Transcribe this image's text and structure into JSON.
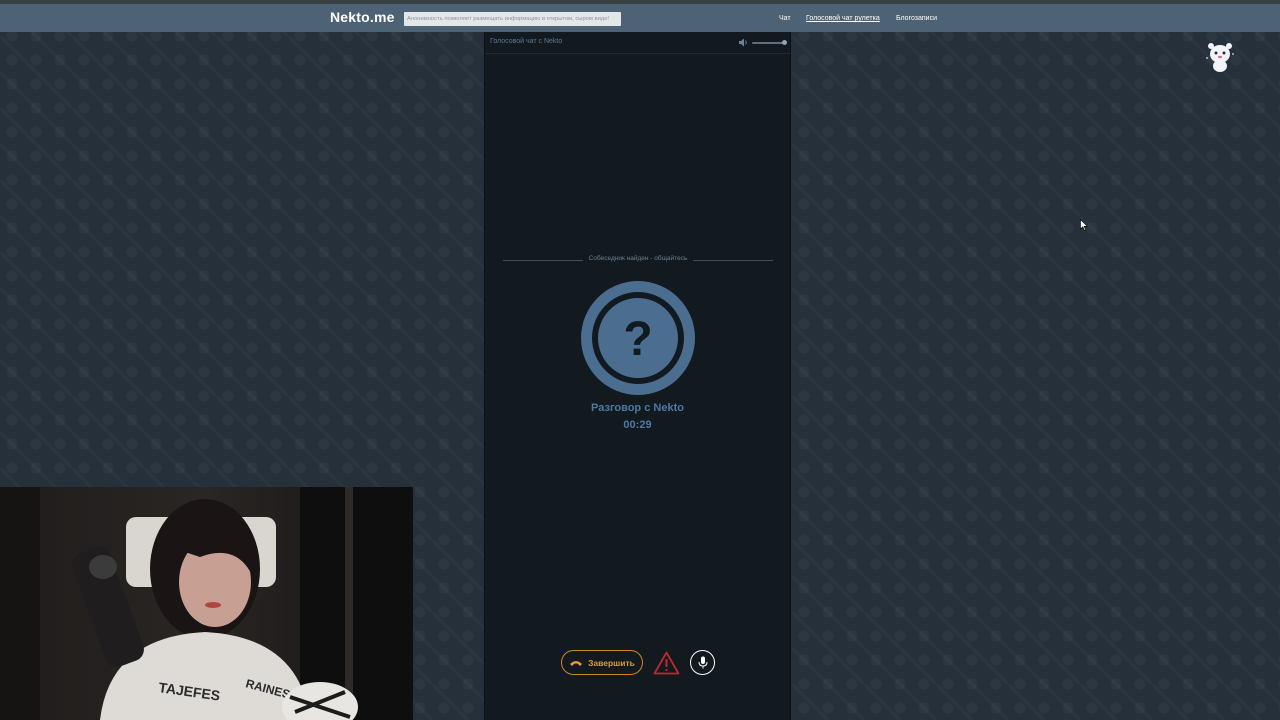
{
  "site": {
    "logo": "Nekto.me",
    "notice": "Анонимность позволяет размещать информацию в открытом, сыром виде!"
  },
  "nav": {
    "items": [
      {
        "label": "Чат",
        "active": false
      },
      {
        "label": "Голосовой чат рулетка",
        "active": true
      },
      {
        "label": "Блогозаписи",
        "active": false
      }
    ]
  },
  "chat": {
    "title": "Голосовой чат с Nekto",
    "status": "Собеседник найден - общайтесь",
    "partner_name": "Разговор с Nekto",
    "timer": "00:29",
    "avatar_symbol": "?"
  },
  "controls": {
    "end_label": "Завершить",
    "volume_level": 0.9
  },
  "icons": {
    "volume": "speaker-icon",
    "end": "phone-hangup-icon",
    "report": "warning-icon",
    "mic": "microphone-icon",
    "mascot": "mascot-icon"
  },
  "colors": {
    "navbar": "#4e6275",
    "accent_blue": "#4f78a3",
    "end_orange": "#e29a2e",
    "warning_red": "#c0272d",
    "panel": "#121a20"
  }
}
